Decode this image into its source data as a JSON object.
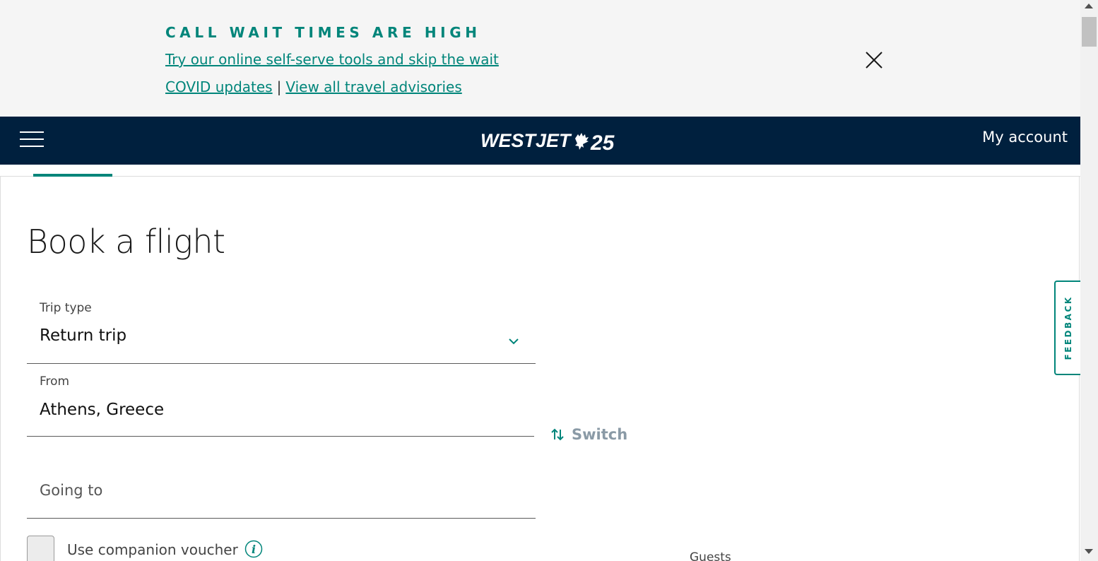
{
  "alert": {
    "title": "CALL WAIT TIMES ARE HIGH",
    "self_serve_link": "Try our online self-serve tools and skip the wait",
    "covid_link": "COVID updates",
    "separator": "|",
    "advisories_link": "View all travel advisories",
    "close_icon": "close-icon"
  },
  "header": {
    "menu_icon": "hamburger-menu-icon",
    "logo_text": "WESTJET",
    "logo_anniversary": "25",
    "my_account": "My account"
  },
  "booking": {
    "title": "Book a flight",
    "trip_type": {
      "label": "Trip type",
      "value": "Return trip"
    },
    "from": {
      "label": "From",
      "value": "Athens, Greece"
    },
    "switch_label": "Switch",
    "going_to": {
      "placeholder": "Going to"
    },
    "companion_voucher": "Use companion voucher",
    "info_icon_glyph": "i",
    "guests_label": "Guests"
  },
  "feedback": {
    "label": "FEEDBACK"
  },
  "colors": {
    "accent": "#00857a",
    "header_bg": "#00203e",
    "banner_bg": "#f5f5f5"
  }
}
